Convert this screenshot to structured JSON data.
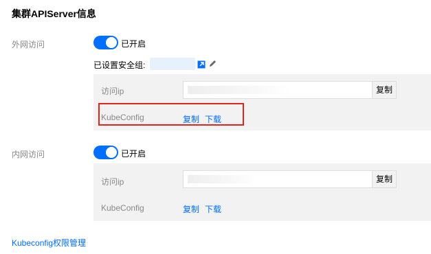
{
  "section_title": "集群APIServer信息",
  "external": {
    "label": "外网访问",
    "switch_state": "on",
    "switch_text": "已开启",
    "security_group_label": "已设置安全组:",
    "ip_label": "访问ip",
    "ip_copy_label": "复制",
    "kubeconfig_label": "KubeConfig",
    "kubeconfig_copy": "复制",
    "kubeconfig_download": "下载"
  },
  "internal": {
    "label": "内网访问",
    "switch_state": "on",
    "switch_text": "已开启",
    "ip_label": "访问ip",
    "ip_copy_label": "复制",
    "kubeconfig_label": "KubeConfig",
    "kubeconfig_copy": "复制",
    "kubeconfig_download": "下载"
  },
  "kubeconfig_permission_link": "Kubeconfig权限管理",
  "colors": {
    "accent": "#006eff",
    "highlight": "#e1251b",
    "panel_bg": "#f2f2f2",
    "muted_text": "#888888"
  },
  "icons": {
    "external_link": "external-link-icon",
    "edit": "pencil-icon"
  }
}
